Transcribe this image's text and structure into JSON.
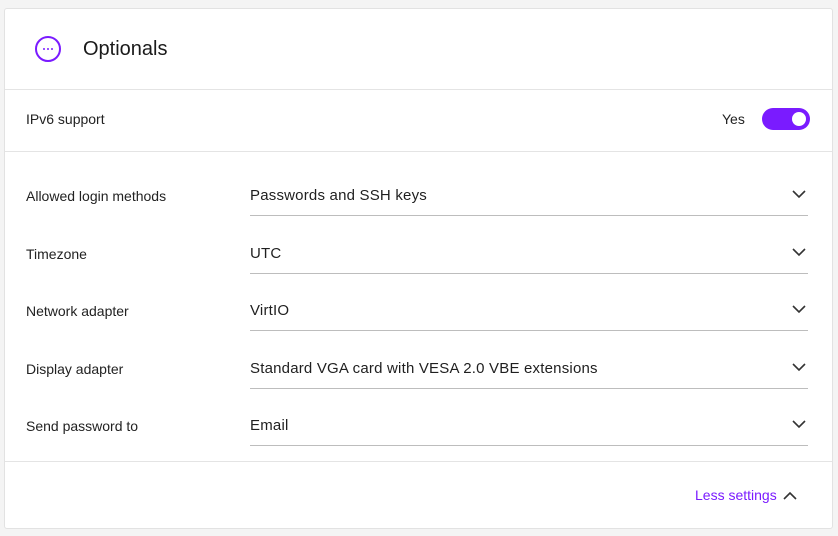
{
  "header": {
    "title": "Optionals",
    "icon": "more-horizontal-circle-icon"
  },
  "ipv6": {
    "label": "IPv6 support",
    "value": "Yes",
    "enabled": true
  },
  "fields": [
    {
      "label": "Allowed login methods",
      "value": "Passwords and SSH keys"
    },
    {
      "label": "Timezone",
      "value": "UTC"
    },
    {
      "label": "Network adapter",
      "value": "VirtIO"
    },
    {
      "label": "Display adapter",
      "value": "Standard VGA card with VESA 2.0 VBE extensions"
    },
    {
      "label": "Send password to",
      "value": "Email"
    }
  ],
  "footer": {
    "toggle_label": "Less settings",
    "icon": "chevron-up-icon"
  },
  "colors": {
    "accent": "#7a1bff",
    "text": "#1f1f1f",
    "divider": "#e4e4e4"
  }
}
